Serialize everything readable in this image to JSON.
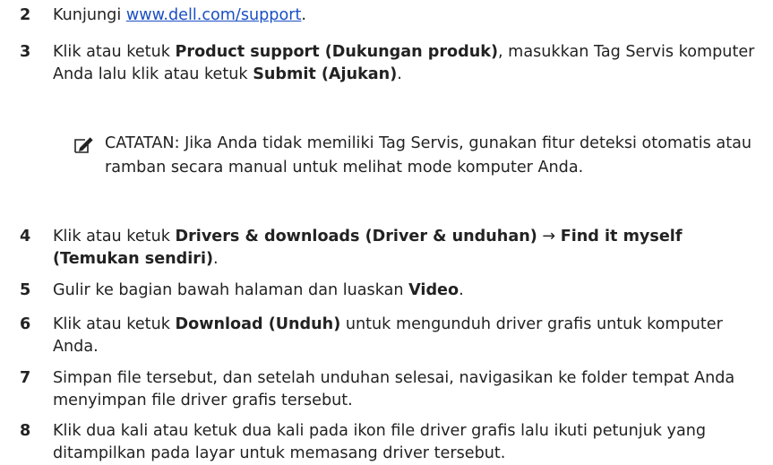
{
  "steps": [
    {
      "number": "2",
      "prefix": "Kunjungi ",
      "link": "www.dell.com/support",
      "suffix": "."
    },
    {
      "number": "3",
      "t1": "Klik atau ketuk ",
      "b1": "Product support (Dukungan produk)",
      "t2": ", masukkan Tag Servis komputer Anda lalu klik atau ketuk ",
      "b2": "Submit (Ajukan)",
      "t3": "."
    },
    {
      "number": "4",
      "t1": "Klik atau ketuk ",
      "b1": "Drivers & downloads (Driver & unduhan)",
      "arrow": " → ",
      "b2": "Find it myself (Temukan sendiri)",
      "t3": "."
    },
    {
      "number": "5",
      "t1": "Gulir ke bagian bawah halaman dan luaskan ",
      "b1": "Video",
      "t2": "."
    },
    {
      "number": "6",
      "t1": "Klik atau ketuk ",
      "b1": "Download (Unduh)",
      "t2": " untuk mengunduh driver grafis untuk komputer Anda."
    },
    {
      "number": "7",
      "text": "Simpan file tersebut, dan setelah unduhan selesai, navigasikan ke folder tempat Anda menyimpan file driver grafis tersebut."
    },
    {
      "number": "8",
      "text": "Klik dua kali atau ketuk dua kali pada ikon file driver grafis lalu ikuti petunjuk yang ditampilkan pada layar untuk memasang driver tersebut."
    }
  ],
  "note": {
    "icon": "pencil-note-icon",
    "title": "CATATAN:",
    "text": " Jika Anda tidak memiliki Tag Servis, gunakan fitur deteksi otomatis atau ramban secara manual untuk melihat mode komputer Anda."
  },
  "colors": {
    "text": "#222222",
    "link": "#1a4fc4"
  }
}
